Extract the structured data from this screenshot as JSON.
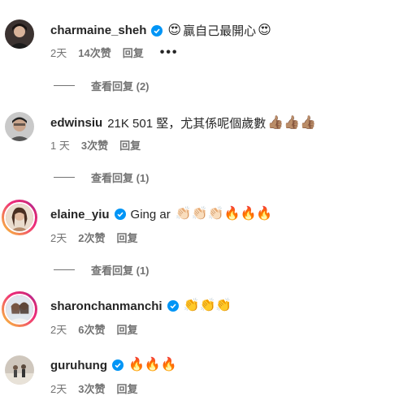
{
  "comments": [
    {
      "username": "charmaine_sheh",
      "verified": true,
      "text_before": "",
      "emoji_lead": "😍",
      "text": "贏自己最開心",
      "emoji_trail": "😍",
      "time": "2天",
      "likes": "14次赞",
      "reply": "回复",
      "more": "•••",
      "view_replies": "查看回复 (2)"
    },
    {
      "username": "edwinsiu",
      "verified": false,
      "text": "21K 501 堅，尤其係呢個歲數",
      "emoji_trail": "👍🏽👍🏽👍🏽",
      "time": "1 天",
      "likes": "3次赞",
      "reply": "回复",
      "view_replies": "查看回复 (1)"
    },
    {
      "username": "elaine_yiu",
      "verified": true,
      "text": "Ging ar",
      "emoji_trail": "👏🏻👏🏻👏🏻🔥🔥🔥",
      "time": "2天",
      "likes": "2次赞",
      "reply": "回复",
      "view_replies": "查看回复 (1)"
    },
    {
      "username": "sharonchanmanchi",
      "verified": true,
      "text": "",
      "emoji_trail": "👏👏👏",
      "time": "2天",
      "likes": "6次赞",
      "reply": "回复"
    },
    {
      "username": "guruhung",
      "verified": true,
      "text": "",
      "emoji_trail": "🔥🔥🔥",
      "time": "2天",
      "likes": "3次赞",
      "reply": "回复"
    }
  ],
  "icons": {
    "verified": "verified-badge-icon",
    "more": "more-options-icon"
  },
  "colors": {
    "verified_blue": "#0095f6",
    "meta_gray": "#737373",
    "text": "#262626"
  }
}
